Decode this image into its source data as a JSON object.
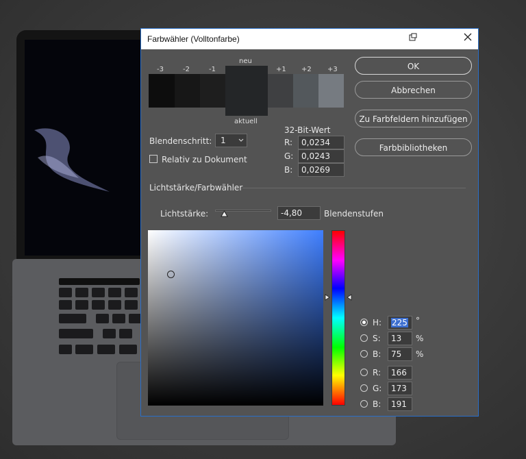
{
  "dialog": {
    "title": "Farbwähler (Volltonfarbe)",
    "swatches": {
      "neu_label": "neu",
      "aktuell_label": "aktuell",
      "steps": [
        "-3",
        "-2",
        "-1",
        "+1",
        "+2",
        "+3"
      ],
      "colors": [
        "#0d0d0d",
        "#171717",
        "#1e1e1e",
        "#242628",
        "#3f4042",
        "#53585c",
        "#767b81"
      ]
    },
    "buttons": {
      "ok": "OK",
      "cancel": "Abbrechen",
      "add_swatches": "Zu Farbfeldern hinzufügen",
      "libraries": "Farbbibliotheken"
    },
    "blendenschritt": {
      "label": "Blendenschritt:",
      "value": "1"
    },
    "relativ": {
      "label": "Relativ zu Dokument",
      "checked": false
    },
    "bit32": {
      "title": "32-Bit-Wert",
      "r_label": "R:",
      "r_value": "0,0234",
      "g_label": "G:",
      "g_value": "0,0243",
      "b_label": "B:",
      "b_value": "0,0269"
    },
    "section_label": "Lichtstärke/Farbwähler",
    "intensity": {
      "label": "Lichtstärke:",
      "value": "-4,80",
      "unit": "Blendenstufen",
      "slider_fraction": 0.17
    },
    "hsb_rgb": {
      "h_label": "H:",
      "h_value": "225",
      "h_unit": "°",
      "s_label": "S:",
      "s_value": "13",
      "s_unit": "%",
      "b_label": "B:",
      "b_value": "75",
      "b_unit": "%",
      "r_label": "R:",
      "r_value": "166",
      "g_label": "G:",
      "g_value": "173",
      "b2_label": "B:",
      "b2_value": "191",
      "selected": "H"
    },
    "hue_color": "#3f7fff"
  }
}
